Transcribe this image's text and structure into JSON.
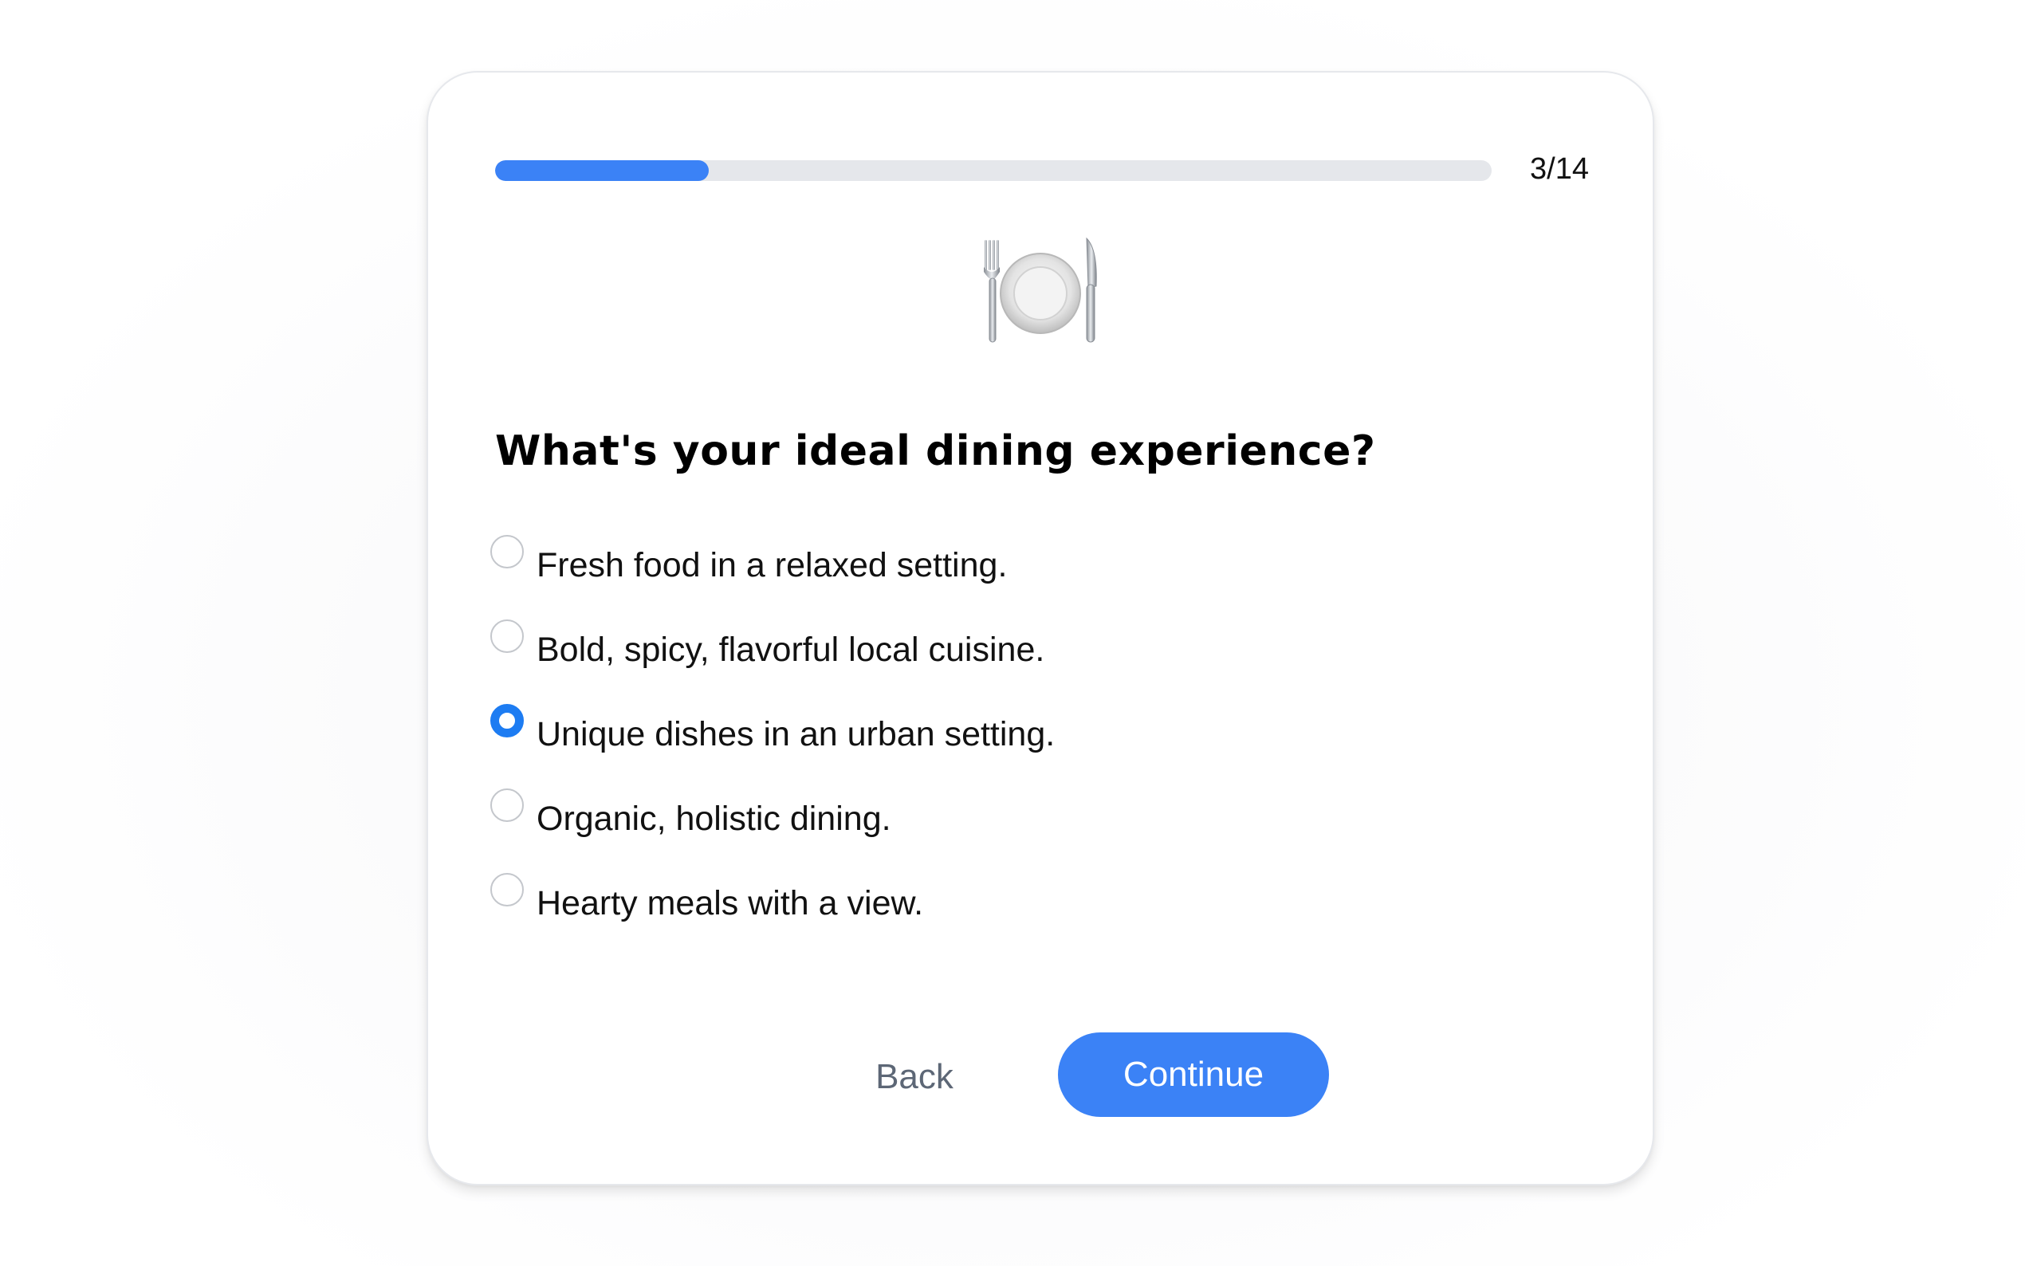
{
  "progress": {
    "step": 3,
    "total": 14,
    "fraction": 0.2143,
    "label": "3/14",
    "fill_color": "#3b82f6"
  },
  "question": {
    "icon": "fork-knife-plate-icon",
    "title": "What's your ideal dining experience?",
    "options": [
      {
        "label": "Fresh food in a relaxed setting.",
        "selected": false
      },
      {
        "label": "Bold, spicy, flavorful local cuisine.",
        "selected": false
      },
      {
        "label": "Unique dishes in an urban setting.",
        "selected": true
      },
      {
        "label": "Organic, holistic dining.",
        "selected": false
      },
      {
        "label": "Hearty meals with a view.",
        "selected": false
      }
    ]
  },
  "buttons": {
    "back_label": "Back",
    "continue_label": "Continue",
    "accent": "#3b82f6"
  }
}
